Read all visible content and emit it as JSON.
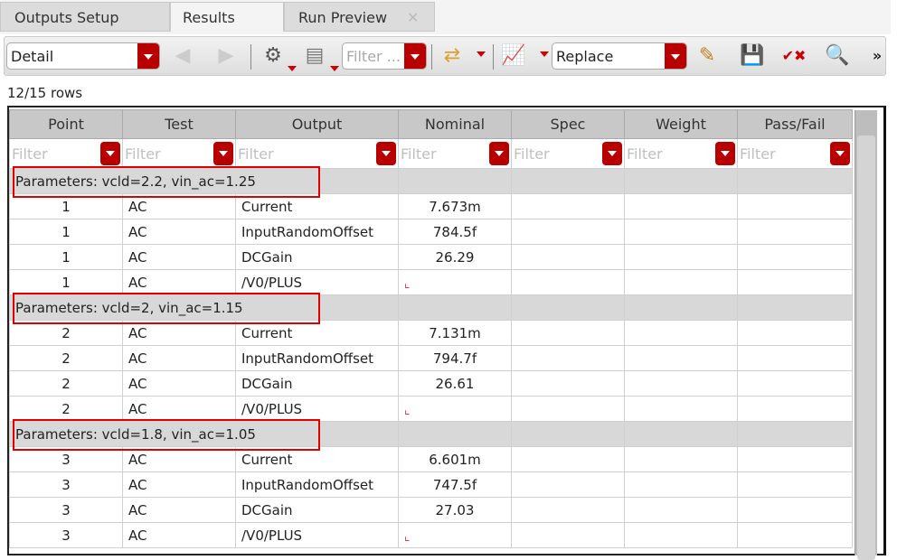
{
  "tabs": [
    {
      "label": "Outputs Setup"
    },
    {
      "label": "Results"
    },
    {
      "label": "Run Preview"
    }
  ],
  "toolbar": {
    "view_select": "Detail",
    "filter_placeholder": "Filter ...",
    "mode_select": "Replace",
    "overflow": "»"
  },
  "row_count": "12/15 rows",
  "columns": [
    "Point",
    "Test",
    "Output",
    "Nominal",
    "Spec",
    "Weight",
    "Pass/Fail"
  ],
  "filter_placeholder": "Filter",
  "groups": [
    {
      "label": "Parameters: vcld=2.2, vin_ac=1.25",
      "rows": [
        {
          "point": "1",
          "test": "AC",
          "output": "Current",
          "nominal": "7.673m"
        },
        {
          "point": "1",
          "test": "AC",
          "output": "InputRandomOffset",
          "nominal": "784.5f"
        },
        {
          "point": "1",
          "test": "AC",
          "output": "DCGain",
          "nominal": "26.29"
        },
        {
          "point": "1",
          "test": "AC",
          "output": "/V0/PLUS",
          "nominal": ""
        }
      ]
    },
    {
      "label": "Parameters: vcld=2, vin_ac=1.15",
      "rows": [
        {
          "point": "2",
          "test": "AC",
          "output": "Current",
          "nominal": "7.131m"
        },
        {
          "point": "2",
          "test": "AC",
          "output": "InputRandomOffset",
          "nominal": "794.7f"
        },
        {
          "point": "2",
          "test": "AC",
          "output": "DCGain",
          "nominal": "26.61"
        },
        {
          "point": "2",
          "test": "AC",
          "output": "/V0/PLUS",
          "nominal": ""
        }
      ]
    },
    {
      "label": "Parameters: vcld=1.8, vin_ac=1.05",
      "rows": [
        {
          "point": "3",
          "test": "AC",
          "output": "Current",
          "nominal": "6.601m"
        },
        {
          "point": "3",
          "test": "AC",
          "output": "InputRandomOffset",
          "nominal": "747.5f"
        },
        {
          "point": "3",
          "test": "AC",
          "output": "DCGain",
          "nominal": "27.03"
        },
        {
          "point": "3",
          "test": "AC",
          "output": "/V0/PLUS",
          "nominal": ""
        }
      ]
    }
  ]
}
